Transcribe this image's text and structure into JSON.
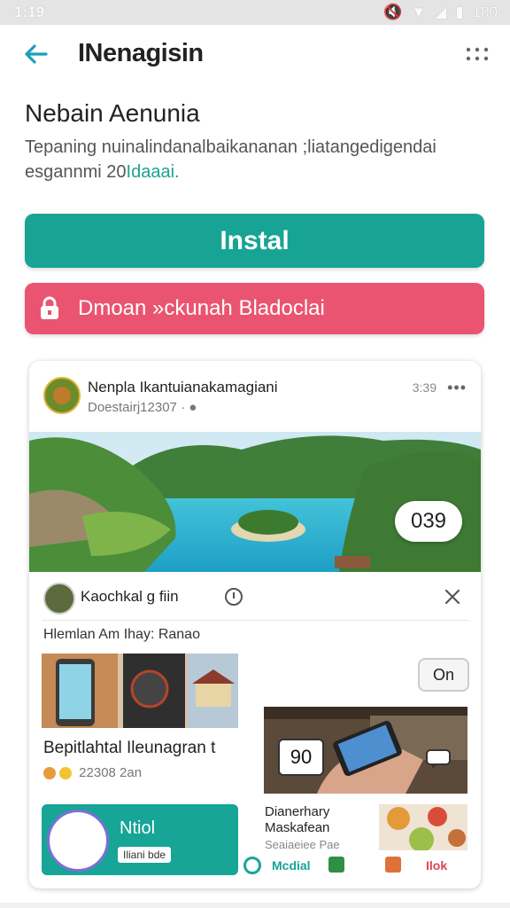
{
  "status_bar": {
    "time": "1:19",
    "battery": "180"
  },
  "toolbar": {
    "title": "INenagisin"
  },
  "app": {
    "name": "Nebain Aenunia",
    "description_line1": "Tepaning nuinalindanalbaikananan ;liatangedigendai",
    "description_line2": "esgannmi 20",
    "description_highlight": "Idaaai."
  },
  "buttons": {
    "install_label": "Instal",
    "secondary_label": "Dmoan »ckunah Bladoclai"
  },
  "post": {
    "author": "Nenpla Ikantuianakamagiani",
    "meta": "Doestairj12307 ·",
    "time": "3:39",
    "count_badge": "039",
    "sub_author": "Kaochkal g fiin",
    "section_label": "Hlemlan Am Ihay: Ranao",
    "item_title": "Bepitlahtal Ileunagran t",
    "item_meta": "22308 2an",
    "small_button": "On",
    "num_badge": "90",
    "teal_label": "Ntiol",
    "teal_tag": "Iliani bde",
    "promo_title_1": "Dianerhary",
    "promo_title_2": "Maskafean",
    "promo_sub": "Seaiaeiee Pae",
    "action_1": "Mcdial",
    "action_2": "Ilok"
  },
  "colors": {
    "primary_teal": "#18a495",
    "secondary_pink": "#ea5470"
  },
  "icons": [
    "back-arrow-icon",
    "more-icon",
    "lock-icon",
    "info-icon",
    "close-icon",
    "chat-icon"
  ]
}
